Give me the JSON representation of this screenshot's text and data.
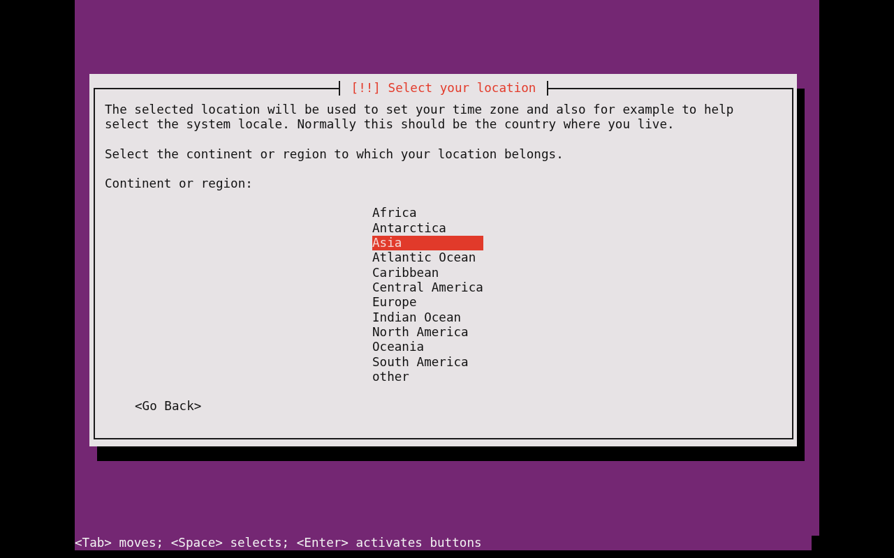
{
  "dialog": {
    "title": "[!!] Select your location",
    "paragraphs": [
      "The selected location will be used to set your time zone and also for example to help select the system locale. Normally this should be the country where you live.",
      "Select the continent or region to which your location belongs."
    ],
    "prompt": "Continent or region:",
    "options": [
      {
        "label": "Africa",
        "selected": false
      },
      {
        "label": "Antarctica",
        "selected": false
      },
      {
        "label": "Asia",
        "selected": true
      },
      {
        "label": "Atlantic Ocean",
        "selected": false
      },
      {
        "label": "Caribbean",
        "selected": false
      },
      {
        "label": "Central America",
        "selected": false
      },
      {
        "label": "Europe",
        "selected": false
      },
      {
        "label": "Indian Ocean",
        "selected": false
      },
      {
        "label": "North America",
        "selected": false
      },
      {
        "label": "Oceania",
        "selected": false
      },
      {
        "label": "South America",
        "selected": false
      },
      {
        "label": "other",
        "selected": false
      }
    ],
    "back_button": "<Go Back>"
  },
  "status_bar": "<Tab> moves; <Space> selects; <Enter> activates buttons"
}
